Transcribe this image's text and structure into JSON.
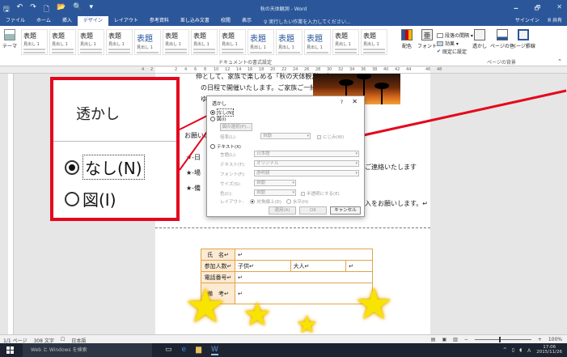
{
  "app": {
    "title": "秋の天体観測 - Word",
    "qat_icons": [
      "save-icon",
      "undo-icon",
      "redo-icon",
      "new-doc-icon",
      "open-icon",
      "print-preview-icon",
      "customize-icon"
    ],
    "qat_glyphs": [
      "🖫",
      "↶",
      "↷",
      "🗋",
      "📂",
      "🔍",
      "▾"
    ],
    "window_controls": [
      "🗕",
      "🗗",
      "✕"
    ]
  },
  "ribbon": {
    "tabs": [
      "ファイル",
      "ホーム",
      "挿入",
      "デザイン",
      "レイアウト",
      "参考資料",
      "差し込み文書",
      "校閲",
      "表示"
    ],
    "active_tab": "デザイン",
    "tell_me": "♀ 実行したい作業を入力してください...",
    "signin": "サインイン",
    "share": "Я 共有",
    "theme_label": "テーマ",
    "styles": [
      {
        "h": "表題",
        "t": "見出し 1"
      },
      {
        "h": "表題",
        "t": "見出し 1"
      },
      {
        "h": "表題",
        "t": "見出し 1"
      },
      {
        "h": "表題",
        "t": "見出し 1"
      },
      {
        "h": "表題",
        "t": "見出し 1"
      },
      {
        "h": "表題",
        "t": "見出し 1"
      },
      {
        "h": "表題",
        "t": "見出し 1"
      },
      {
        "h": "表題",
        "t": "見出し 1"
      },
      {
        "h": "表題",
        "t": "見出し 1"
      },
      {
        "h": "表題",
        "t": "見出し 1"
      },
      {
        "h": "表題",
        "t": "見出し 1"
      },
      {
        "h": "表題",
        "t": "見出し 1"
      },
      {
        "h": "表題",
        "t": "見出し 1"
      }
    ],
    "doc_format_label": "ドキュメントの書式設定",
    "colors_label": "配色",
    "fonts_label": "フォント",
    "paragraph_spacing": "段落の間隔 ▾",
    "effects": "効果 ▾",
    "set_default": "既定に設定",
    "watermark_label": "透かし",
    "page_color_label": "ページの色",
    "page_borders_label": "ページ罫線",
    "page_bg_group": "ページの背景"
  },
  "ruler": {
    "numbers": [
      "4",
      "2",
      "",
      "2",
      "4",
      "6",
      "8",
      "10",
      "12",
      "14",
      "16",
      "18",
      "20",
      "22",
      "24",
      "26",
      "28",
      "30",
      "32",
      "34",
      "36",
      "38",
      "40",
      "42",
      "44",
      "",
      "46",
      "48"
    ]
  },
  "document": {
    "line1": "伸として、家族で楽しめる「秋の天体観測の会」",
    "line2": "の日程で開催いたします。ご家族ご一緒に秋の",
    "line3": "ゆっくりと",
    "line4": "お願いいた",
    "bullet1": "★-日",
    "bullet2": "★-場",
    "bullet3": "★-備",
    "trail1": "ご連絡いたします",
    "trail2": "入をお願いします。↵",
    "form": {
      "r1": {
        "h": "氏　名↵",
        "v": "↵"
      },
      "r2": {
        "h": "参加人数↵",
        "v1": "子供↵",
        "v2": "大人↵",
        "v3": "↵"
      },
      "r3": {
        "h": "電話番号↵",
        "v": "↵"
      },
      "r4": {
        "h": "備　考↵",
        "v": "↵"
      }
    },
    "para_mark": "↵"
  },
  "callout": {
    "title": "透かし",
    "option1": "なし(N)",
    "option2": "図(I)"
  },
  "dialog": {
    "title": "透かし",
    "help": "?",
    "close": "✕",
    "opt_none": "なし(N)",
    "opt_picture": "図(I)",
    "select_picture": "図の選択(P)...",
    "scale_label": "倍率(L):",
    "scale_value": "自動",
    "washout": "にじみ(W)",
    "opt_text": "テキスト(X)",
    "language_label": "言語(L):",
    "language_value": "日本語",
    "text_label": "テキスト(T):",
    "text_value": "オリジナル",
    "font_label": "フォント(F):",
    "font_value": "游明朝",
    "size_label": "サイズ(S):",
    "size_value": "自動",
    "color_label": "色(C):",
    "color_value": "自動",
    "semitransparent": "半透明にする(E)",
    "layout_label": "レイアウト:",
    "layout_diagonal": "対角線上(D)",
    "layout_horizontal": "水平(H)",
    "apply": "適用(A)",
    "ok": "OK",
    "cancel": "キャンセル"
  },
  "status": {
    "page": "1/1 ページ",
    "words": "308 文字",
    "lang": "日本語",
    "zoom": "100%"
  },
  "taskbar": {
    "search": "Web と Windows を検索",
    "time": "17:06",
    "date": "2015/11/26"
  }
}
